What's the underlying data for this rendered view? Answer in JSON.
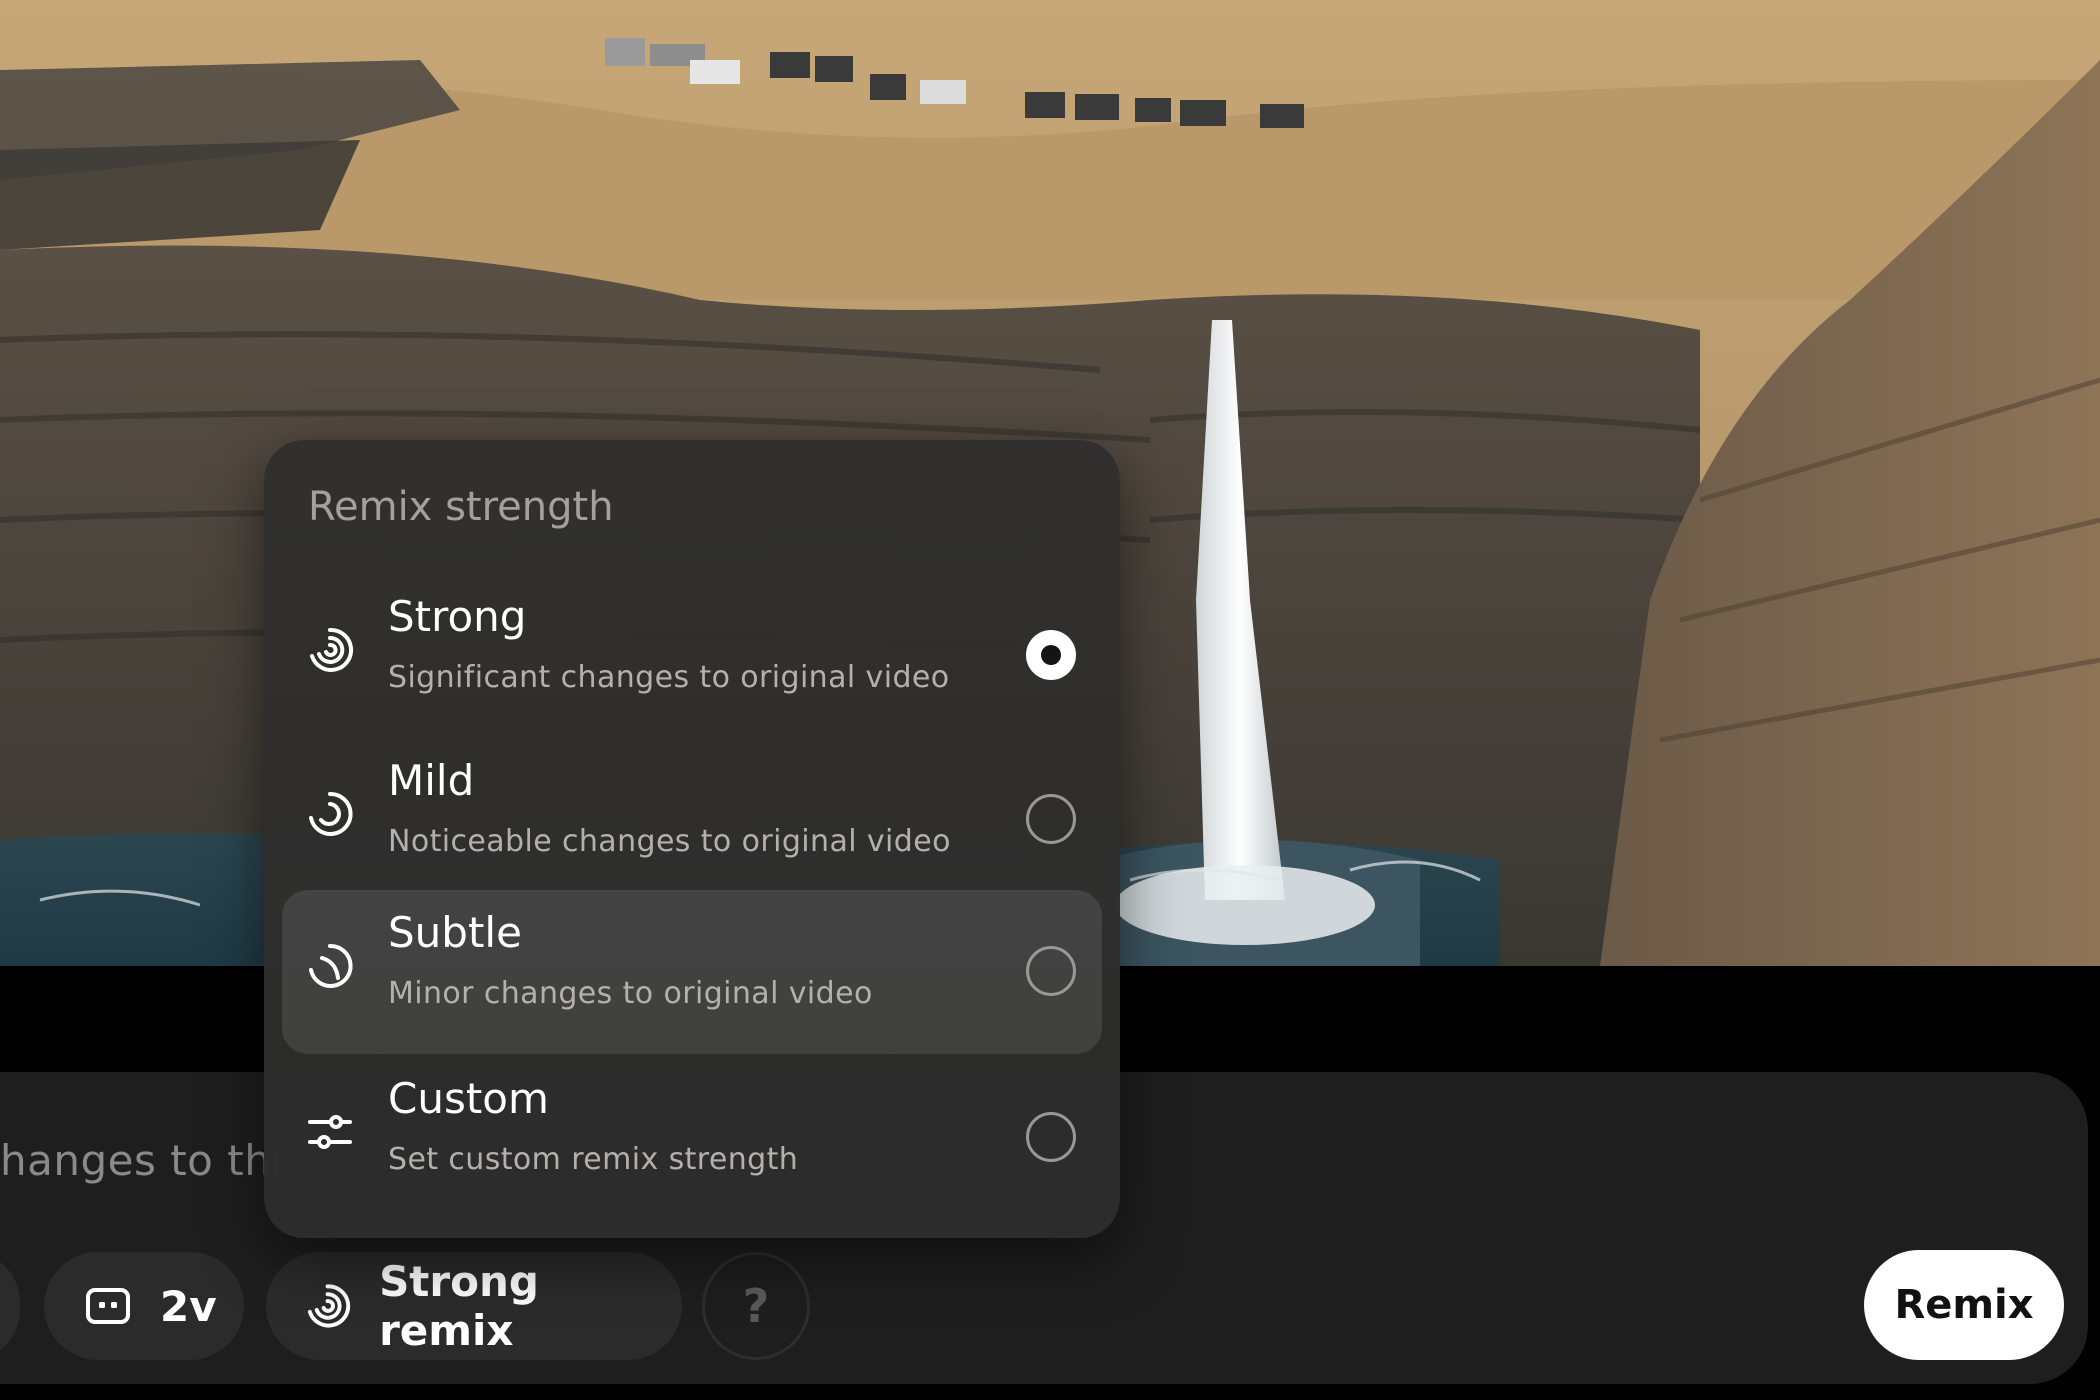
{
  "popover": {
    "title": "Remix strength",
    "options": [
      {
        "label": "Strong",
        "description": "Significant changes to original video",
        "icon": "spiral-icon",
        "selected": true
      },
      {
        "label": "Mild",
        "description": "Noticeable changes to original video",
        "icon": "swirl-icon",
        "selected": false
      },
      {
        "label": "Subtle",
        "description": "Minor changes to original video",
        "icon": "soft-swirl-icon",
        "selected": false
      },
      {
        "label": "Custom",
        "description": "Set custom remix strength",
        "icon": "sliders-icon",
        "selected": false
      }
    ]
  },
  "composer": {
    "prompt_text": "hanges to thi",
    "ratio_label": "2v",
    "remix_mode_label": "Strong remix",
    "help_label": "?",
    "remix_button_label": "Remix"
  },
  "colors": {
    "popover_bg": "#2d2c2a",
    "composer_bg": "#1e1e1e",
    "accent": "#ffffff"
  }
}
